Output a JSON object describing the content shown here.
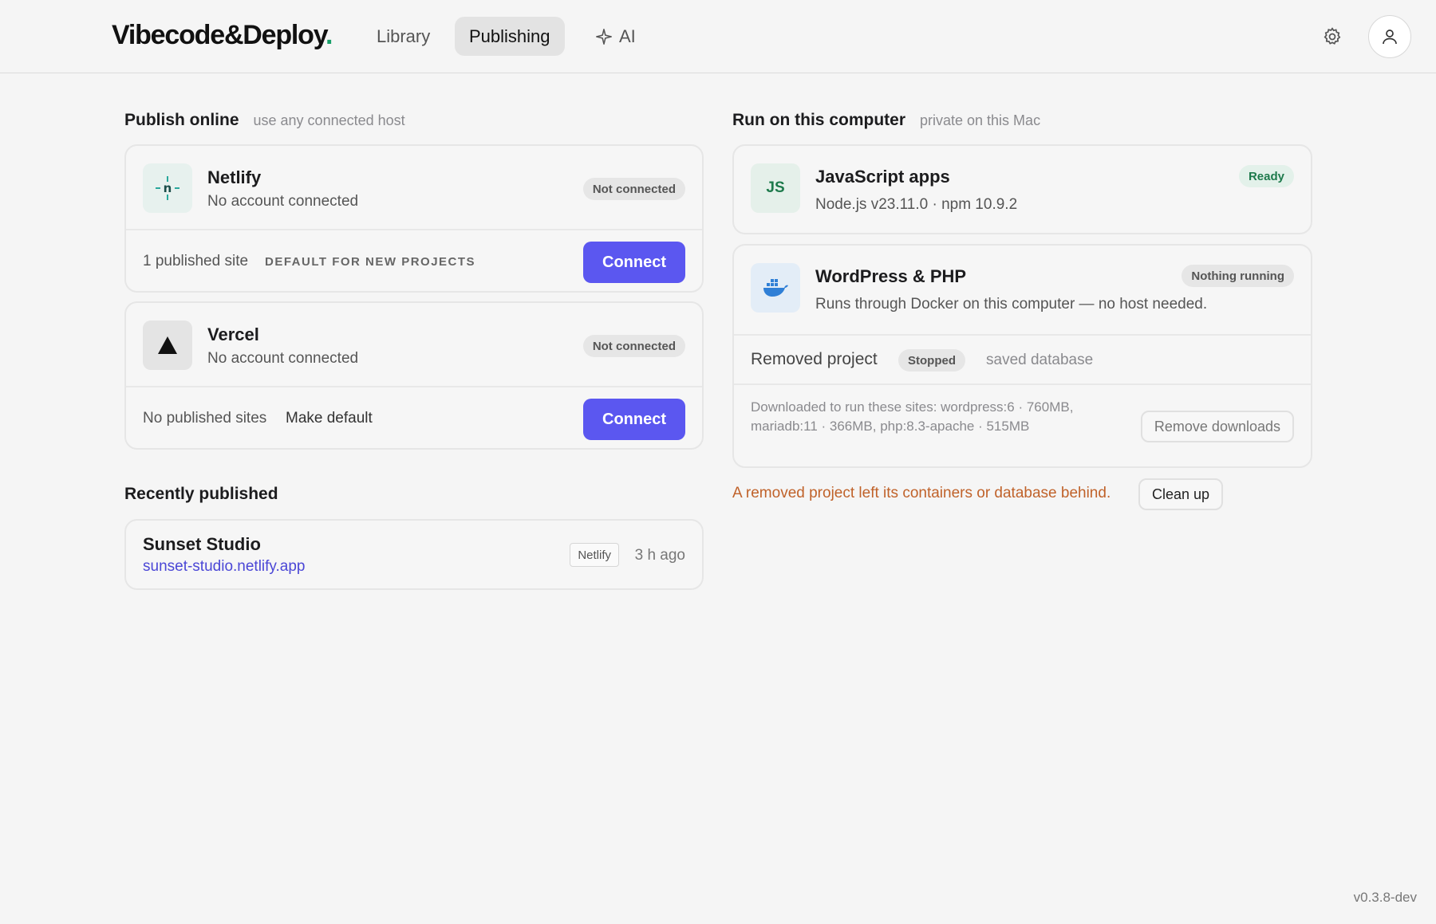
{
  "header": {
    "logo_text": "Vibecode&Deploy",
    "logo_dot": ".",
    "nav": [
      {
        "label": "Library"
      },
      {
        "label": "Publishing",
        "active": true
      },
      {
        "label": "AI",
        "icon": "sparkle-icon"
      }
    ],
    "icons": [
      "gear-icon",
      "user-icon"
    ]
  },
  "publish_online": {
    "title": "Publish online",
    "subtitle": "use any connected host",
    "hosts": [
      {
        "name": "Netlify",
        "icon": "netlify-icon",
        "status_text": "No account connected",
        "badge": "Not connected",
        "sites_text": "1 published site",
        "default_text": "DEFAULT FOR NEW PROJECTS",
        "button": "Connect"
      },
      {
        "name": "Vercel",
        "icon": "vercel-triangle-icon",
        "status_text": "No account connected",
        "badge": "Not connected",
        "sites_text": "No published sites",
        "make_default": "Make default",
        "button": "Connect"
      }
    ]
  },
  "recently_published": {
    "title": "Recently published",
    "items": [
      {
        "name": "Sunset Studio",
        "url": "sunset-studio.netlify.app",
        "host": "Netlify",
        "time": "3 h ago"
      }
    ]
  },
  "run_local": {
    "title": "Run on this computer",
    "subtitle": "private on this Mac",
    "javascript": {
      "icon_text": "JS",
      "name": "JavaScript apps",
      "versions": "Node.js v23.11.0 · npm 10.9.2",
      "badge": "Ready"
    },
    "wordpress": {
      "icon": "docker-whale-icon",
      "name": "WordPress & PHP",
      "desc": "Runs through Docker on this computer — no host needed.",
      "badge": "Nothing running",
      "removed_label": "Removed project",
      "removed_badge": "Stopped",
      "removed_note": "saved database",
      "downloads_text": "Downloaded to run these sites: wordpress:6 · 760MB, mariadb:11 · 366MB, php:8.3-apache · 515MB",
      "remove_button": "Remove downloads"
    },
    "warning": "A removed project left its containers or database behind.",
    "cleanup_button": "Clean up"
  },
  "colors": {
    "accent": "#5b57f0",
    "brand_dot": "#18a06a",
    "warning": "#c0622a",
    "ready": "#1e7a4c",
    "link": "#4b47d6"
  },
  "footer": {
    "version": "v0.3.8-dev"
  }
}
